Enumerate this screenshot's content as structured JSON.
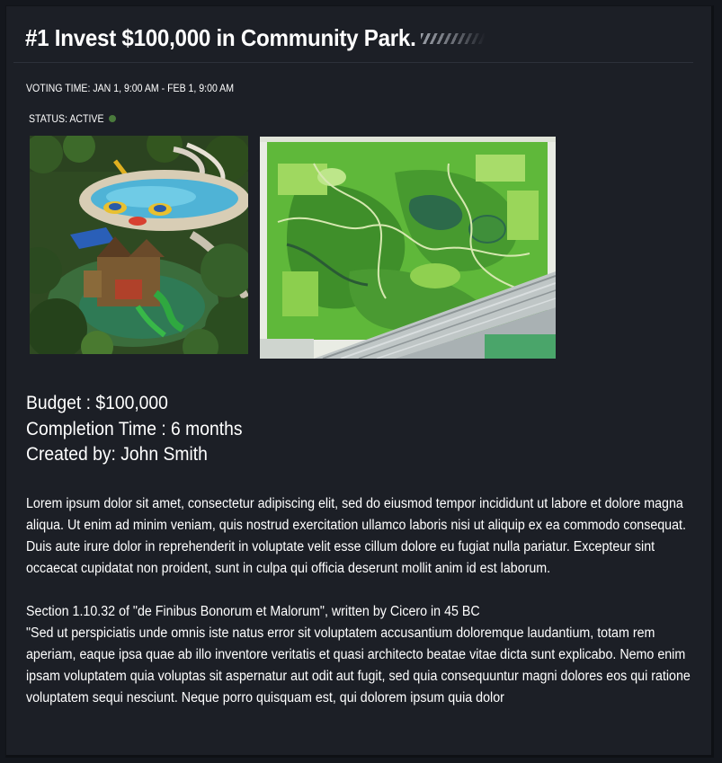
{
  "proposal": {
    "title": "#1 Invest $100,000 in Community Park.",
    "voting_time": "VOTING TIME: JAN 1, 9:00 AM - FEB 1, 9:00 AM",
    "status": "STATUS: ACTIVE",
    "status_color": "#4a7a3c",
    "images": [
      {
        "name": "waterpark-photo"
      },
      {
        "name": "park-site-plan"
      }
    ],
    "budget": "Budget : $100,000",
    "completion_time": "Completion Time : 6 months",
    "created_by": "Created by: John Smith",
    "description_1": "Lorem ipsum dolor sit amet, consectetur adipiscing elit, sed do eiusmod tempor incididunt ut labore et dolore magna aliqua. Ut enim ad minim veniam, quis nostrud exercitation ullamco laboris nisi ut aliquip ex ea commodo consequat. Duis aute irure dolor in reprehenderit in voluptate velit esse cillum dolore eu fugiat nulla pariatur. Excepteur sint occaecat cupidatat non proident, sunt in culpa qui officia deserunt mollit anim id est laborum.",
    "section_heading": "Section 1.10.32 of \"de Finibus Bonorum et Malorum\", written by Cicero in 45 BC",
    "description_2": "\"Sed ut perspiciatis unde omnis iste natus error sit voluptatem accusantium doloremque laudantium, totam rem aperiam, eaque ipsa quae ab illo inventore veritatis et quasi architecto beatae vitae dicta sunt explicabo. Nemo enim ipsam voluptatem quia voluptas sit aspernatur aut odit aut fugit, sed quia consequuntur magni dolores eos qui ratione voluptatem sequi nesciunt. Neque porro quisquam est, qui dolorem ipsum quia dolor"
  },
  "theme": {
    "background": "#14171d",
    "panel": "#1c1f26",
    "text": "#ffffff"
  }
}
